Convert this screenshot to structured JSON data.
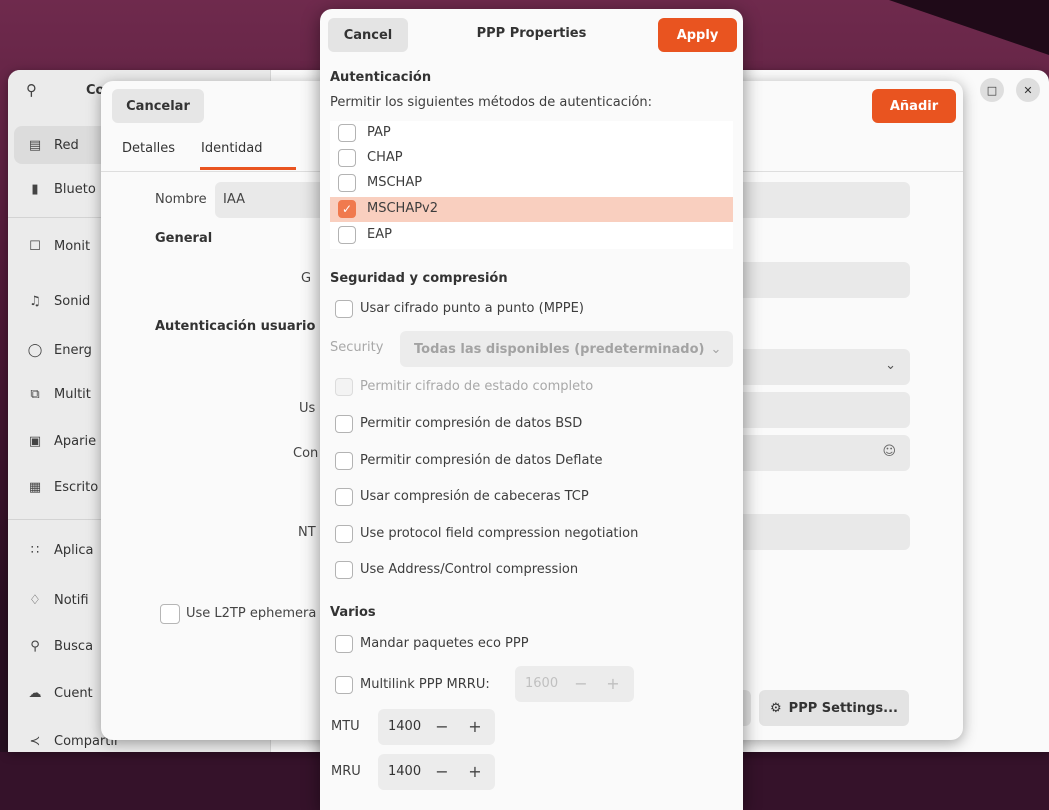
{
  "settings": {
    "title": "Co",
    "sidebar": [
      {
        "label": "Red",
        "icon": "network-icon"
      },
      {
        "label": "Blueto",
        "icon": "bluetooth-icon"
      },
      {
        "label": "Monit",
        "icon": "monitor-icon"
      },
      {
        "label": "Sonid",
        "icon": "sound-icon"
      },
      {
        "label": "Energ",
        "icon": "power-icon"
      },
      {
        "label": "Multit",
        "icon": "multitasking-icon"
      },
      {
        "label": "Aparie",
        "icon": "appearance-icon"
      },
      {
        "label": "Escrito",
        "icon": "desktop-icon"
      },
      {
        "label": "Aplica",
        "icon": "apps-icon"
      },
      {
        "label": "Notifi",
        "icon": "bell-icon"
      },
      {
        "label": "Busca",
        "icon": "search-icon"
      },
      {
        "label": "Cuent",
        "icon": "cloud-icon"
      },
      {
        "label": "Compartir",
        "icon": "share-icon"
      }
    ]
  },
  "vpn": {
    "cancel": "Cancelar",
    "add": "Añadir",
    "tabs": [
      "Detalles",
      "Identidad"
    ],
    "nombre_label": "Nombre",
    "nombre_value": "IAA",
    "general": "General",
    "gateway_frag": "G",
    "auth_user": "Autenticación usuario",
    "user_frag": "Us",
    "pass_frag": "Con",
    "nt_frag": "NT",
    "l2tp": "Use L2TP ephemera",
    "ppp_settings": "PPP Settings..."
  },
  "ppp": {
    "cancel": "Cancel",
    "title": "PPP Properties",
    "apply": "Apply",
    "auth_section": "Autenticación",
    "auth_desc": "Permitir los siguientes métodos de autenticación:",
    "methods": [
      {
        "label": "PAP",
        "checked": false
      },
      {
        "label": "CHAP",
        "checked": false
      },
      {
        "label": "MSCHAP",
        "checked": false
      },
      {
        "label": "MSCHAPv2",
        "checked": true
      },
      {
        "label": "EAP",
        "checked": false
      }
    ],
    "security_section": "Seguridad y compresión",
    "mppe": "Usar cifrado punto a punto (MPPE)",
    "security_label": "Security",
    "security_value": "Todas las disponibles (predeterminado)",
    "stateful": "Permitir cifrado de estado completo",
    "bsd": "Permitir compresión de datos BSD",
    "deflate": "Permitir compresión de datos Deflate",
    "tcp": "Usar compresión de cabeceras TCP",
    "protofield": "Use protocol field compression negotiation",
    "addrctl": "Use Address/Control compression",
    "misc_section": "Varios",
    "echo": "Mandar paquetes eco PPP",
    "multilink": "Multilink PPP MRRU:",
    "mrru_value": "1600",
    "mtu_label": "MTU",
    "mtu_value": "1400",
    "mru_label": "MRU",
    "mru_value": "1400"
  }
}
